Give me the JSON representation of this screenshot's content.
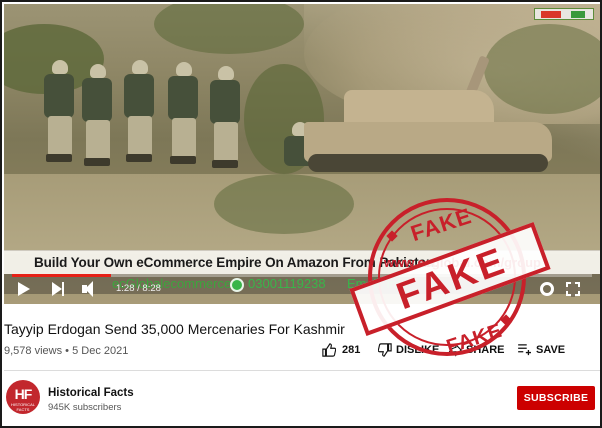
{
  "video": {
    "ad_overlay": {
      "headline": "Build Your Own eCommerce Empire On Amazon From Pakistan:",
      "url": "www.ecglobal.com/group",
      "contact_left": "ecGlobalecommerce",
      "phone": "03001119238",
      "email": "Email: info"
    },
    "player": {
      "time_display": "1:28 / 8:28",
      "progress_fraction": 0.17,
      "accent_color": "#e62117"
    }
  },
  "title": "Tayyip Erdogan Send 35,000 Mercenaries For Kashmir",
  "meta": {
    "views": "9,578 views",
    "separator": "•",
    "date": "5 Dec 2021"
  },
  "actions": {
    "like_count": "281",
    "dislike_label": "DISLIKE",
    "share_label": "SHARE",
    "save_label": "SAVE"
  },
  "channel": {
    "name": "Historical Facts",
    "subscribers": "945K subscribers",
    "avatar_letters": "HF",
    "avatar_sub": "HISTORICAL FACTS",
    "subscribe_label": "SUBSCRIBE",
    "subscribe_color": "#cc0000"
  },
  "stamp": {
    "top": "FAKE",
    "main": "FAKE",
    "bottom": "FAKE",
    "color": "#c8202a"
  },
  "icons": [
    "play-icon",
    "next-icon",
    "volume-icon",
    "settings-icon",
    "fullscreen-icon",
    "like-icon",
    "dislike-icon",
    "share-icon",
    "save-icon",
    "whatsapp-icon"
  ]
}
